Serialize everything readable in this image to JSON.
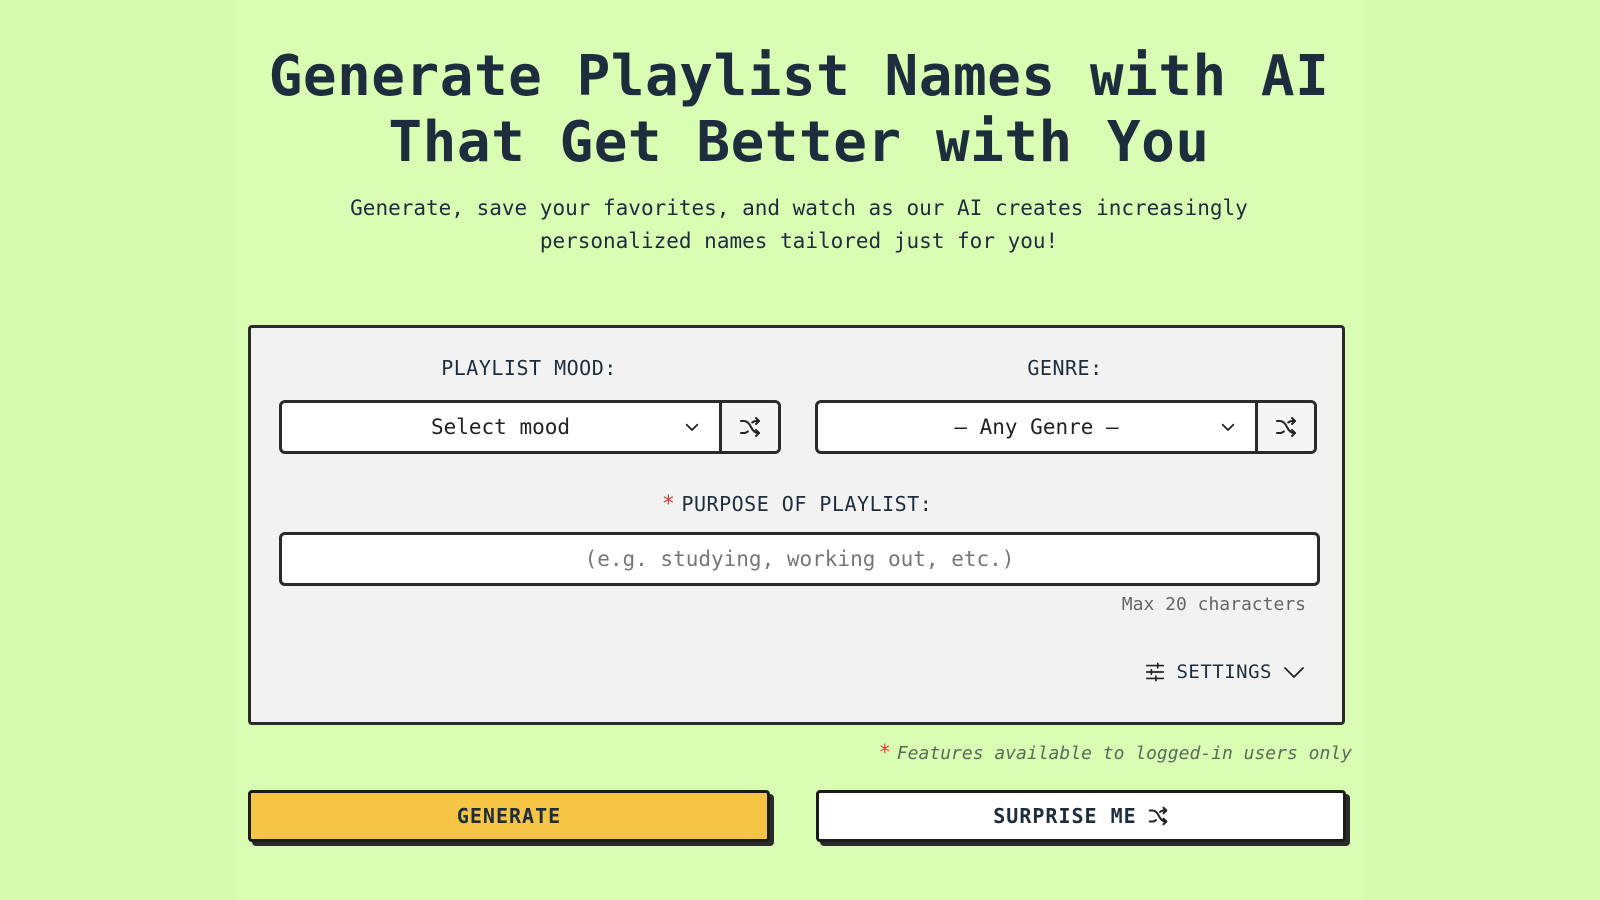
{
  "hero": {
    "title_line1": "Generate Playlist Names with AI",
    "title_line2": "That Get Better with You",
    "subtitle_line1": "Generate, save your favorites, and watch as our AI creates increasingly",
    "subtitle_line2": "personalized names tailored just for you!"
  },
  "form": {
    "mood": {
      "label": "PLAYLIST MOOD:",
      "selected": "Select mood",
      "shuffle_icon": "shuffle-icon"
    },
    "genre": {
      "label": "GENRE:",
      "selected": "— Any Genre —",
      "shuffle_icon": "shuffle-icon"
    },
    "purpose": {
      "required_marker": "*",
      "label": "PURPOSE OF PLAYLIST:",
      "value": "",
      "placeholder": "(e.g. studying, working out, etc.)",
      "hint": "Max 20 characters"
    },
    "settings": {
      "label": "SETTINGS",
      "icon": "sliders-icon",
      "chevron": "chevron-down-icon"
    }
  },
  "note": {
    "marker": "*",
    "text": "Features available to logged-in users only"
  },
  "actions": {
    "generate_label": "GENERATE",
    "surprise_label": "SURPRISE ME"
  },
  "colors": {
    "background": "#d9fdb3",
    "card": "#f2f2f2",
    "generate_button": "#f7c545",
    "required": "#e03b3b",
    "text": "#1e2d3d"
  }
}
